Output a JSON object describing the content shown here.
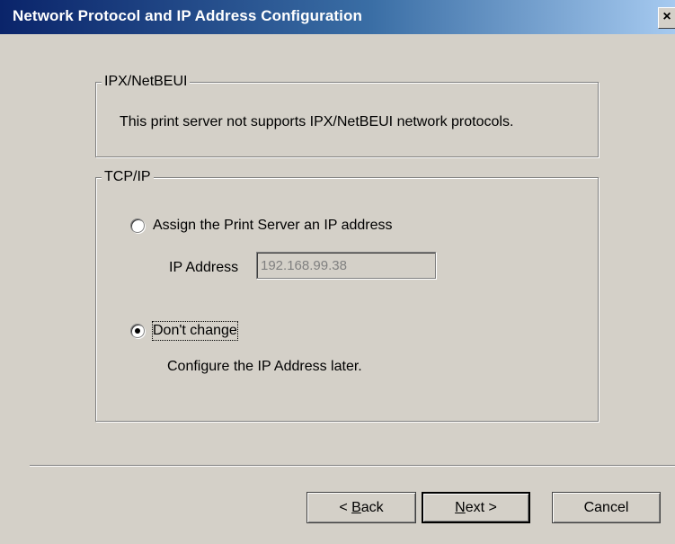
{
  "window": {
    "title": "Network Protocol and IP Address Configuration",
    "close_label": "×"
  },
  "ipx_group": {
    "legend": "IPX/NetBEUI",
    "message": "This print server not supports IPX/NetBEUI network protocols."
  },
  "tcp_group": {
    "legend": "TCP/IP",
    "assign_option": {
      "label": "Assign the Print Server an IP address",
      "checked": false
    },
    "ip_label": "IP Address",
    "ip_value": "192.168.99.38",
    "dont_change_option": {
      "label": "Don't change",
      "checked": true
    },
    "hint": "Configure the IP Address later."
  },
  "buttons": {
    "back_prefix": "< ",
    "back_mnemonic": "B",
    "back_rest": "ack",
    "next_mnemonic": "N",
    "next_rest": "ext >",
    "cancel_label": "Cancel"
  }
}
